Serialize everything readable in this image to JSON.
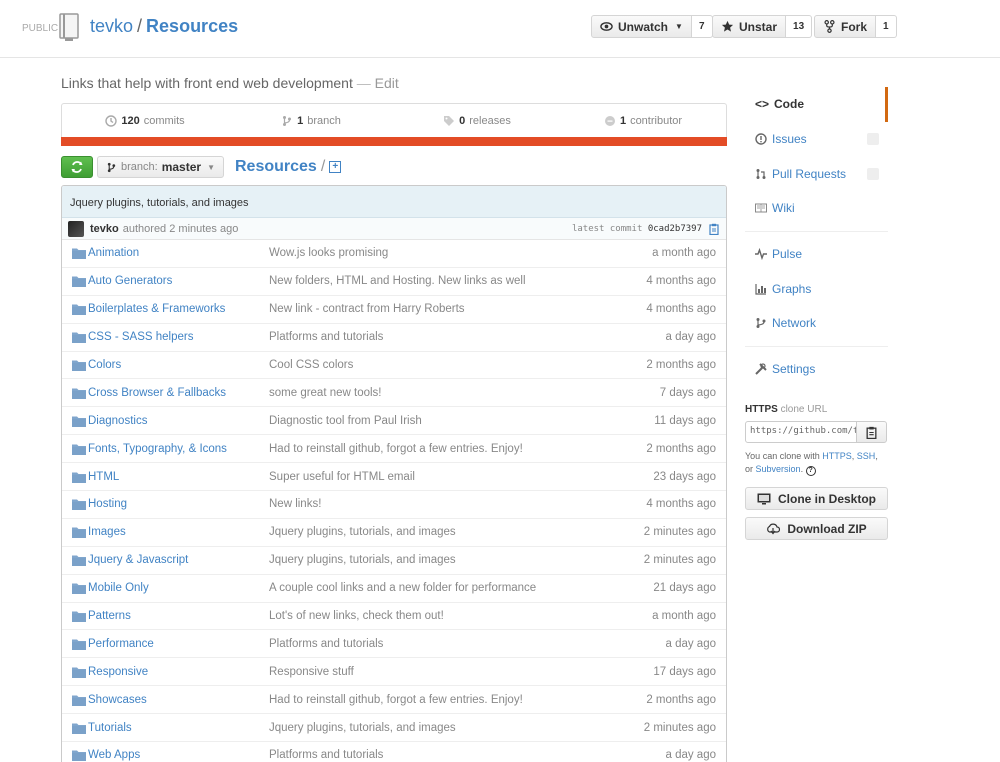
{
  "header": {
    "visibility": "PUBLIC",
    "owner": "tevko",
    "separator": "/",
    "repo": "Resources",
    "unwatch_label": "Unwatch",
    "watch_count": "7",
    "unstar_label": "Unstar",
    "star_count": "13",
    "fork_label": "Fork",
    "fork_count": "1"
  },
  "description": {
    "text": "Links that help with front end web development",
    "dash": "—",
    "edit": "Edit"
  },
  "summary": {
    "commits_num": "120",
    "commits_label": "commits",
    "branch_num": "1",
    "branch_label": "branch",
    "releases_num": "0",
    "releases_label": "releases",
    "contributor_num": "1",
    "contributor_label": "contributor"
  },
  "colors": {
    "language_bar": "#e34c26",
    "accent": "#4183c4",
    "compare_green": "#4cae3c"
  },
  "filenav": {
    "compare_icon": "sync-icon",
    "branch_label": "branch:",
    "branch_name": "master",
    "breadcrumb": "Resources",
    "slash": "/",
    "new_file": "+"
  },
  "commit": {
    "message": "Jquery plugins, tutorials, and images",
    "author": "tevko",
    "authored": "authored 2 minutes ago",
    "latest_label": "latest commit",
    "sha": "0cad2b7397"
  },
  "files": [
    {
      "name": "Animation",
      "message": "Wow.js looks promising",
      "age": "a month ago"
    },
    {
      "name": "Auto Generators",
      "message": "New folders, HTML and Hosting. New links as well",
      "age": "4 months ago"
    },
    {
      "name": "Boilerplates & Frameworks",
      "message": "New link - contract from Harry Roberts",
      "age": "4 months ago"
    },
    {
      "name": "CSS - SASS helpers",
      "message": "Platforms and tutorials",
      "age": "a day ago"
    },
    {
      "name": "Colors",
      "message": "Cool CSS colors",
      "age": "2 months ago"
    },
    {
      "name": "Cross Browser & Fallbacks",
      "message": "some great new tools!",
      "age": "7 days ago"
    },
    {
      "name": "Diagnostics",
      "message": "Diagnostic tool from Paul Irish",
      "age": "11 days ago"
    },
    {
      "name": "Fonts, Typography, & Icons",
      "message": "Had to reinstall github, forgot a few entries. Enjoy!",
      "age": "2 months ago"
    },
    {
      "name": "HTML",
      "message": "Super useful for HTML email",
      "age": "23 days ago"
    },
    {
      "name": "Hosting",
      "message": "New links!",
      "age": "4 months ago"
    },
    {
      "name": "Images",
      "message": "Jquery plugins, tutorials, and images",
      "age": "2 minutes ago"
    },
    {
      "name": "Jquery & Javascript",
      "message": "Jquery plugins, tutorials, and images",
      "age": "2 minutes ago"
    },
    {
      "name": "Mobile Only",
      "message": "A couple cool links and a new folder for performance",
      "age": "21 days ago"
    },
    {
      "name": "Patterns",
      "message": "Lot's of new links, check them out!",
      "age": "a month ago"
    },
    {
      "name": "Performance",
      "message": "Platforms and tutorials",
      "age": "a day ago"
    },
    {
      "name": "Responsive",
      "message": "Responsive stuff",
      "age": "17 days ago"
    },
    {
      "name": "Showcases",
      "message": "Had to reinstall github, forgot a few entries. Enjoy!",
      "age": "2 months ago"
    },
    {
      "name": "Tutorials",
      "message": "Jquery plugins, tutorials, and images",
      "age": "2 minutes ago"
    },
    {
      "name": "Web Apps",
      "message": "Platforms and tutorials",
      "age": "a day ago"
    }
  ],
  "sidebar": {
    "code": "Code",
    "issues": "Issues",
    "pull_requests": "Pull Requests",
    "wiki": "Wiki",
    "pulse": "Pulse",
    "graphs": "Graphs",
    "network": "Network",
    "settings": "Settings"
  },
  "clone": {
    "protocol": "HTTPS",
    "label": "clone URL",
    "url": "https://github.com/tevko/Resources.git",
    "help_prefix": "You can clone with",
    "https": "HTTPS",
    "ssh": "SSH",
    "or": "or",
    "subversion": "Subversion",
    "comma": ",",
    "period": ".",
    "help_icon": "?",
    "desktop_label": "Clone in Desktop",
    "zip_label": "Download ZIP"
  }
}
